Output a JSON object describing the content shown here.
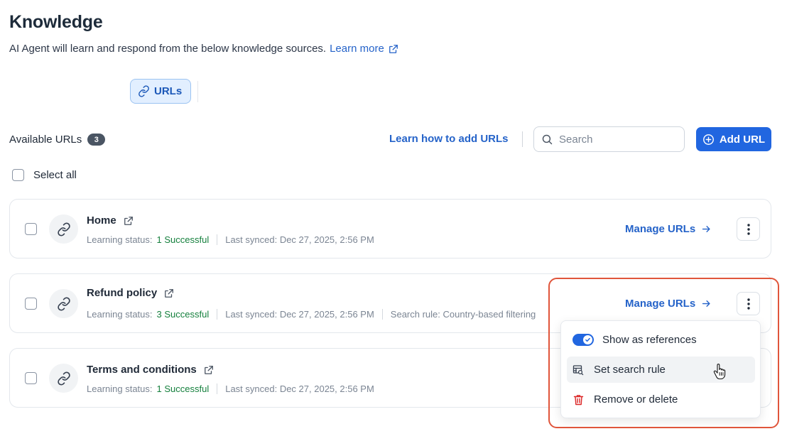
{
  "header": {
    "title": "Knowledge",
    "subtitle": "AI Agent will learn and respond from the below knowledge sources.",
    "learn_more": "Learn more"
  },
  "tabs": [
    {
      "label": "URLs",
      "icon": "link-icon",
      "selected": true
    }
  ],
  "toolbar": {
    "available_label": "Available URLs",
    "count": "3",
    "learn_how": "Learn how to add URLs",
    "search_placeholder": "Search",
    "add_button": "Add URL"
  },
  "select_all": "Select all",
  "items": [
    {
      "title": "Home",
      "status_label": "Learning status:",
      "status_value": "1 Successful",
      "last_synced": "Last synced: Dec 27, 2025, 2:56 PM",
      "manage": "Manage URLs"
    },
    {
      "title": "Refund policy",
      "status_label": "Learning status:",
      "status_value": "3 Successful",
      "last_synced": "Last synced: Dec 27, 2025, 2:56 PM",
      "search_rule": "Search rule: Country-based filtering",
      "manage": "Manage URLs"
    },
    {
      "title": "Terms and conditions",
      "status_label": "Learning status:",
      "status_value": "1 Successful",
      "last_synced": "Last synced: Dec 27, 2025, 2:56 PM"
    }
  ],
  "menu": {
    "show_references": "Show as references",
    "show_references_on": true,
    "set_search_rule": "Set search rule",
    "remove": "Remove or delete"
  },
  "colors": {
    "accent": "#2166e0",
    "link": "#2563c9",
    "success": "#15803d",
    "danger": "#dc2626",
    "highlight": "#e0553b"
  }
}
